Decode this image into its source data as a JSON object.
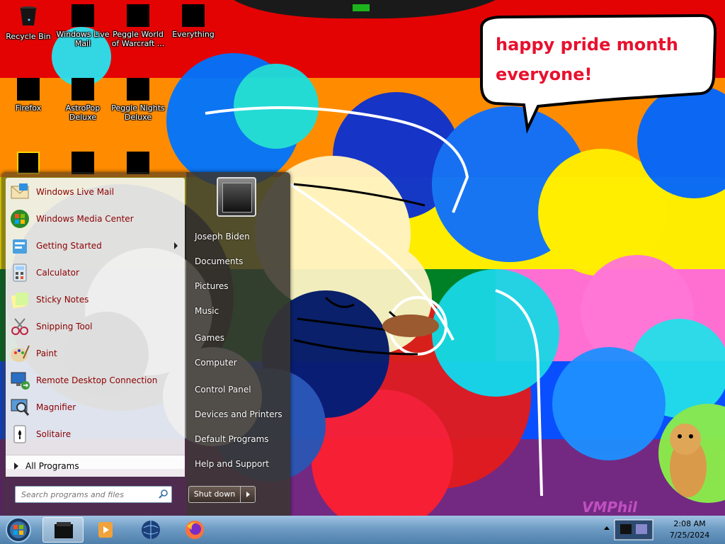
{
  "desktop": {
    "icons": [
      {
        "label": "Recycle Bin"
      },
      {
        "label": "Windows Live Mail"
      },
      {
        "label": "Peggle World of Warcraft ..."
      },
      {
        "label": "Everything"
      },
      {
        "label": "Firefox"
      },
      {
        "label": "AstroPop Deluxe"
      },
      {
        "label": "Peggle Nights Deluxe"
      }
    ],
    "speech_bubble": {
      "line1": "happy pride month",
      "line2": "everyone!"
    },
    "watermark": "VMPhil"
  },
  "start_menu": {
    "programs": [
      {
        "label": "Windows Live Mail",
        "icon": "mail-icon",
        "has_submenu": false
      },
      {
        "label": "Windows Media Center",
        "icon": "media-center-icon",
        "has_submenu": false
      },
      {
        "label": "Getting Started",
        "icon": "getting-started-icon",
        "has_submenu": true
      },
      {
        "label": "Calculator",
        "icon": "calculator-icon",
        "has_submenu": false
      },
      {
        "label": "Sticky Notes",
        "icon": "sticky-notes-icon",
        "has_submenu": false
      },
      {
        "label": "Snipping Tool",
        "icon": "scissors-icon",
        "has_submenu": false
      },
      {
        "label": "Paint",
        "icon": "paint-palette-icon",
        "has_submenu": false
      },
      {
        "label": "Remote Desktop Connection",
        "icon": "remote-desktop-icon",
        "has_submenu": false
      },
      {
        "label": "Magnifier",
        "icon": "magnifier-icon",
        "has_submenu": false
      },
      {
        "label": "Solitaire",
        "icon": "solitaire-icon",
        "has_submenu": false
      }
    ],
    "all_programs_label": "All Programs",
    "search_placeholder": "Search programs and files",
    "right_items": [
      {
        "label": "Joseph Biden"
      },
      {
        "label": "Documents"
      },
      {
        "label": "Pictures"
      },
      {
        "label": "Music"
      },
      {
        "label": "Games"
      },
      {
        "label": "Computer"
      },
      {
        "label": "Control Panel"
      },
      {
        "label": "Devices and Printers"
      },
      {
        "label": "Default Programs"
      },
      {
        "label": "Help and Support"
      }
    ],
    "shutdown_label": "Shut down"
  },
  "taskbar": {
    "pinned": [
      {
        "name": "window-app-icon",
        "active": true
      },
      {
        "name": "media-player-icon",
        "active": false
      },
      {
        "name": "globe-icon",
        "active": false
      },
      {
        "name": "firefox-icon",
        "active": false
      }
    ],
    "clock": {
      "time": "2:08 AM",
      "date": "7/25/2024"
    }
  },
  "colors": {
    "wallpaper_stripes": [
      "#e40303",
      "#ff8c00",
      "#0077ff",
      "#ffed00",
      "#008026",
      "#24408e",
      "#732982"
    ],
    "menu_text": "#8b0000",
    "bubble_text": "#e8112d"
  }
}
